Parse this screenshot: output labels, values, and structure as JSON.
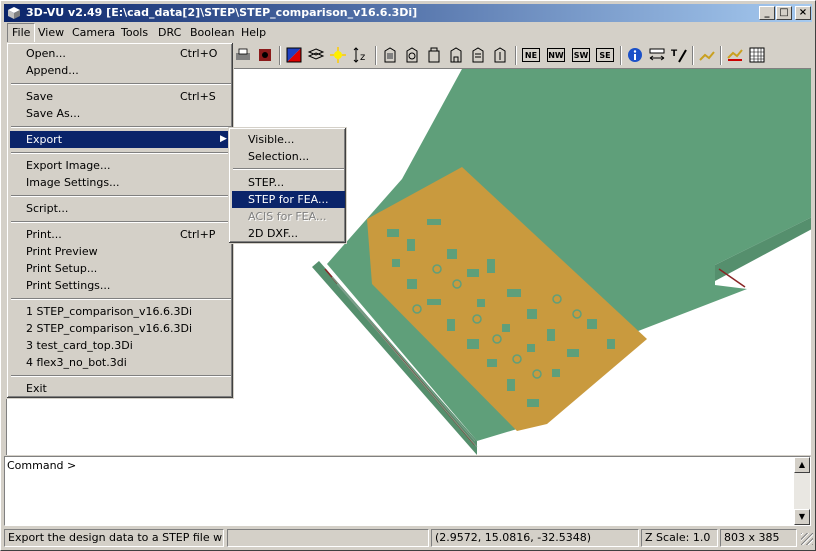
{
  "window": {
    "title": "3D-VU v2.49 [E:\\cad_data[2]\\STEP\\STEP_comparison_v16.6.3Di]"
  },
  "menubar": [
    "File",
    "View",
    "Camera",
    "Tools",
    "DRC",
    "Boolean",
    "Help"
  ],
  "file_menu": {
    "open": "Open...",
    "open_sc": "Ctrl+O",
    "append": "Append...",
    "save": "Save",
    "save_sc": "Ctrl+S",
    "save_as": "Save As...",
    "export": "Export",
    "export_image": "Export Image...",
    "image_settings": "Image Settings...",
    "script": "Script...",
    "print": "Print...",
    "print_sc": "Ctrl+P",
    "print_preview": "Print Preview",
    "print_setup": "Print Setup...",
    "print_settings": "Print Settings...",
    "recent1": "1 STEP_comparison_v16.6.3Di",
    "recent2": "2 STEP_comparison_v16.6.3Di",
    "recent3": "3 test_card_top.3Di",
    "recent4": "4 flex3_no_bot.3di",
    "exit": "Exit"
  },
  "export_menu": {
    "visible": "Visible...",
    "selection": "Selection...",
    "step": "STEP...",
    "step_fea": "STEP for FEA...",
    "acis_fea": "ACIS for FEA...",
    "dxf": "2D DXF..."
  },
  "toolbar": {
    "ne": "NE",
    "nw": "NW",
    "sw": "SW",
    "se": "SE"
  },
  "command": {
    "label": "Command >"
  },
  "status": {
    "message": "Export the design data to a STEP file with FE",
    "coords": "(2.9572, 15.0816, -32.5348)",
    "zscale": "Z Scale: 1.0",
    "size": "803 x 385"
  },
  "colors": {
    "board_green": "#5f9f7a",
    "copper": "#c99a3e",
    "menu_highlight": "#0a246a",
    "title_bar": "#0a246a"
  }
}
